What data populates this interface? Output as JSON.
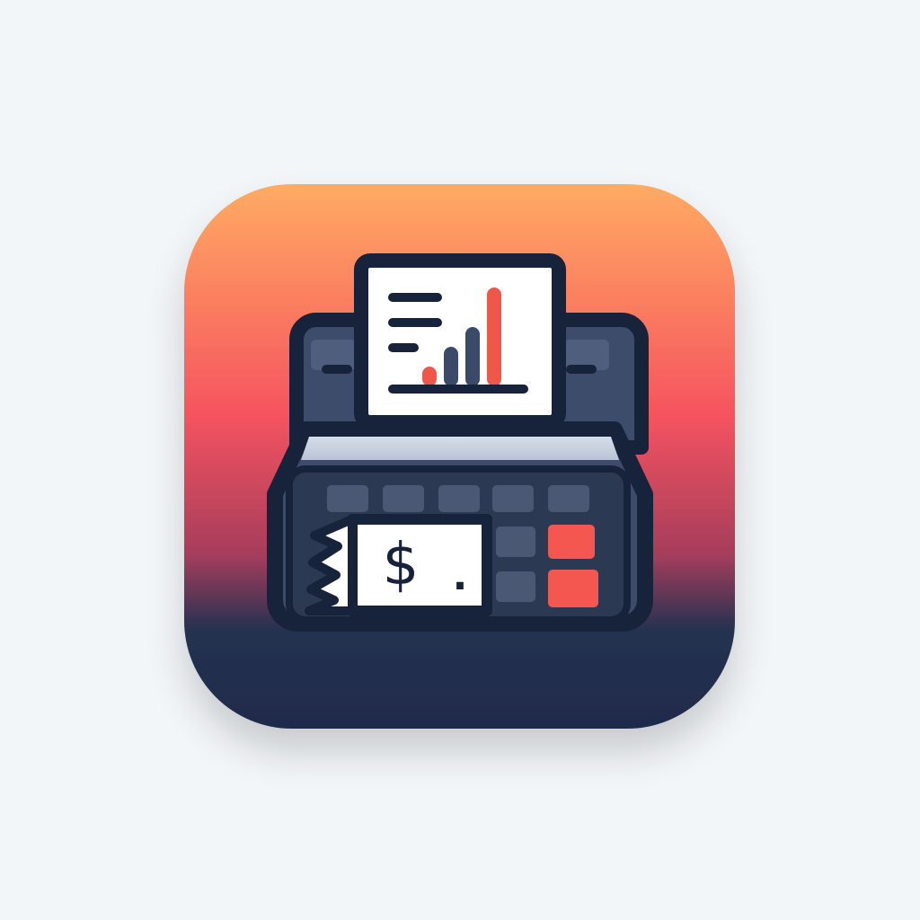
{
  "icon": {
    "name": "cash-register-app-icon",
    "receipt_symbol": "$",
    "receipt_dot": ".",
    "chart_data": {
      "type": "bar",
      "categories": [
        "",
        "",
        "",
        ""
      ],
      "values": [
        1,
        2,
        3,
        5
      ],
      "bar_colors": [
        "#f0574b",
        "#3a4a68",
        "#3a4a68",
        "#f0574b"
      ]
    }
  },
  "colors": {
    "background": "#f3f6f9",
    "gradient_top": "#ffab63",
    "gradient_mid": "#f6545f",
    "gradient_bottom": "#1f2b4b",
    "outline": "#17223b",
    "body": "#3d4c6b",
    "key_dark": "#4a5873",
    "key_accent": "#f4574f",
    "paper": "#ffffff"
  }
}
